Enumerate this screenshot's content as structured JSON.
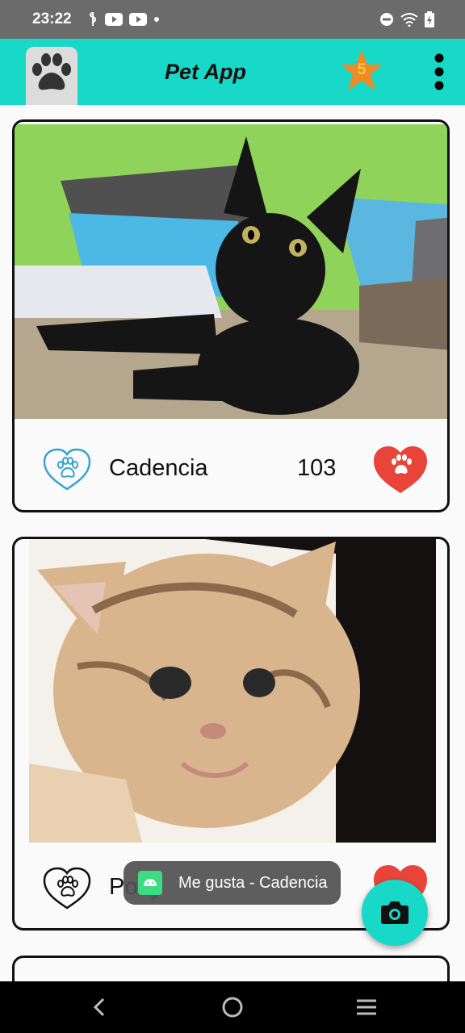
{
  "status_bar": {
    "time": "23:22",
    "icons_left": [
      "vpn-icon",
      "youtube-icon",
      "youtube-icon",
      "dot-icon"
    ],
    "icons_right": [
      "do-not-disturb-icon",
      "wifi-icon",
      "battery-charging-icon"
    ]
  },
  "app_bar": {
    "title": "Pet App",
    "logo": "paw-icon",
    "badge_count": "5",
    "menu": "more-vert-icon"
  },
  "cards": [
    {
      "name": "Cadencia",
      "likes": "103",
      "photo": "black-kitten-photo",
      "status_icon": "paw-heart-outline-icon-blue",
      "action_icon": "paw-heart-filled-icon"
    },
    {
      "name": "Potty",
      "likes": "",
      "photo": "tabby-kitten-photo",
      "status_icon": "paw-heart-outline-icon-black",
      "action_icon": "paw-heart-filled-icon"
    }
  ],
  "toast": {
    "text": "Me gusta - Cadencia"
  },
  "fab": {
    "icon": "camera-icon"
  },
  "nav_bar": {
    "buttons": [
      "back-icon",
      "home-icon",
      "recents-icon"
    ]
  },
  "colors": {
    "accent": "#18d8c8",
    "like_red": "#e8443a",
    "star_orange": "#f08a24",
    "badge_text": "#f2c84b"
  }
}
